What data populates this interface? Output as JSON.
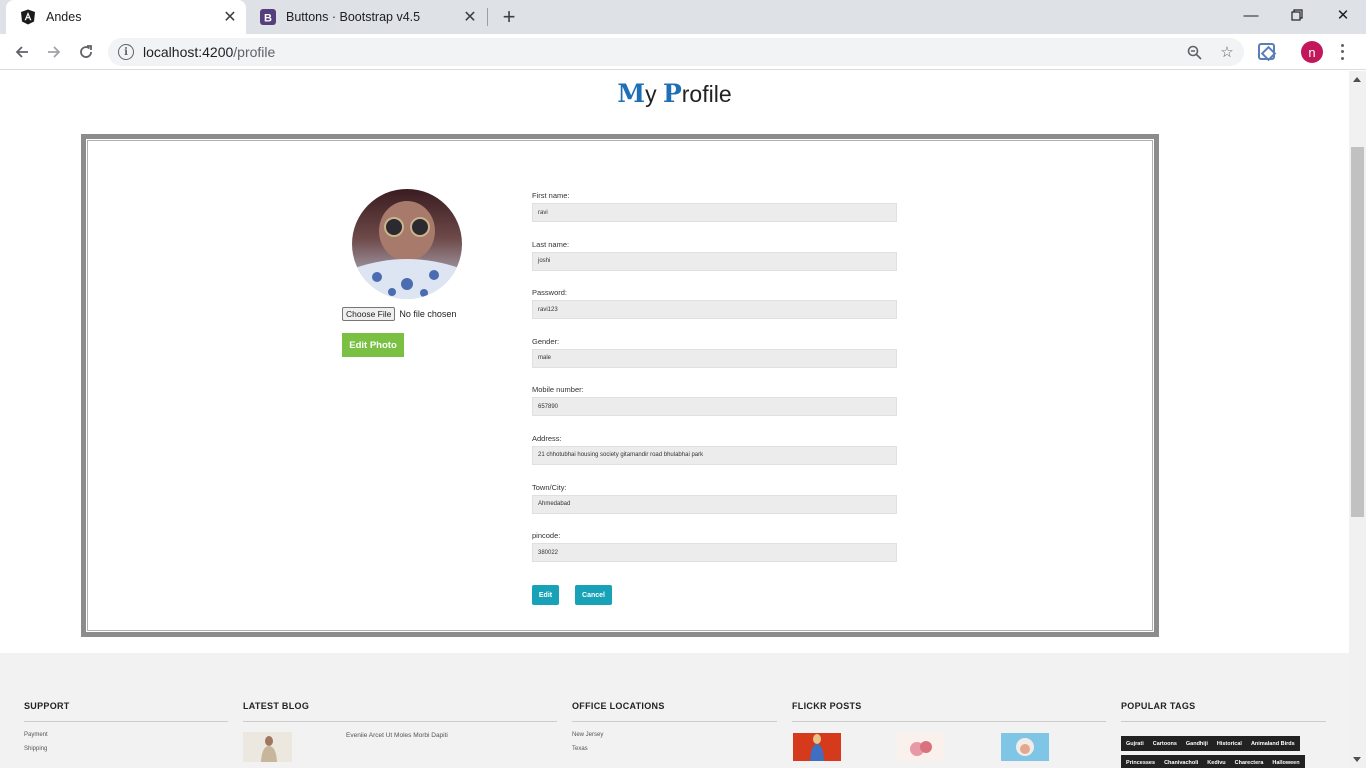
{
  "browser": {
    "tabs": [
      {
        "title": "Andes",
        "favicon": "angular-icon",
        "active": true
      },
      {
        "title": "Buttons · Bootstrap v4.5",
        "favicon": "bootstrap-icon",
        "active": false
      }
    ],
    "url_host": "localhost:4200",
    "url_path": "/profile",
    "avatar_letter": "n",
    "avatar_color": "#c2185b"
  },
  "page": {
    "title_cap1": "M",
    "title_rest1": "y ",
    "title_cap2": "P",
    "title_rest2": "rofile"
  },
  "photo": {
    "choose_file_label": "Choose File",
    "no_file_text": "No file chosen",
    "edit_photo_label": "Edit Photo"
  },
  "form": {
    "fields": [
      {
        "label": "First name:",
        "value": "ravi"
      },
      {
        "label": "Last name:",
        "value": "joshi"
      },
      {
        "label": "Password:",
        "value": "ravi123"
      },
      {
        "label": "Gender:",
        "value": "male"
      },
      {
        "label": "Mobile number:",
        "value": "657890"
      },
      {
        "label": "Address:",
        "value": "21 chhotubhai housing society gitamandir road bhulabhai park"
      },
      {
        "label": "Town/City:",
        "value": "Ahmedabad"
      },
      {
        "label": "pincode:",
        "value": "380022"
      }
    ],
    "edit_label": "Edit",
    "cancel_label": "Cancel"
  },
  "footer": {
    "support": {
      "heading": "SUPPORT",
      "links": [
        "Payment",
        "Shipping"
      ]
    },
    "blog": {
      "heading": "LATEST BLOG",
      "post": "Eveniie Arcet Ut Moles Morbi Dapiti"
    },
    "offices": {
      "heading": "OFFICE LOCATIONS",
      "links": [
        "New Jersey",
        "Texas"
      ]
    },
    "flickr": {
      "heading": "FLICKR POSTS"
    },
    "tags": {
      "heading": "POPULAR TAGS",
      "row1": [
        "Gujrati",
        "Cartoons",
        "Gandhiji",
        "Historical",
        "Animaland Birds"
      ],
      "row2": [
        "Princesses",
        "Chanivacholi",
        "Kedivu",
        "Charectera",
        "Halloween"
      ]
    }
  },
  "colors": {
    "accent_green": "#7ac143",
    "accent_teal": "#17a2b8",
    "title_blue": "#1e6fb5"
  }
}
